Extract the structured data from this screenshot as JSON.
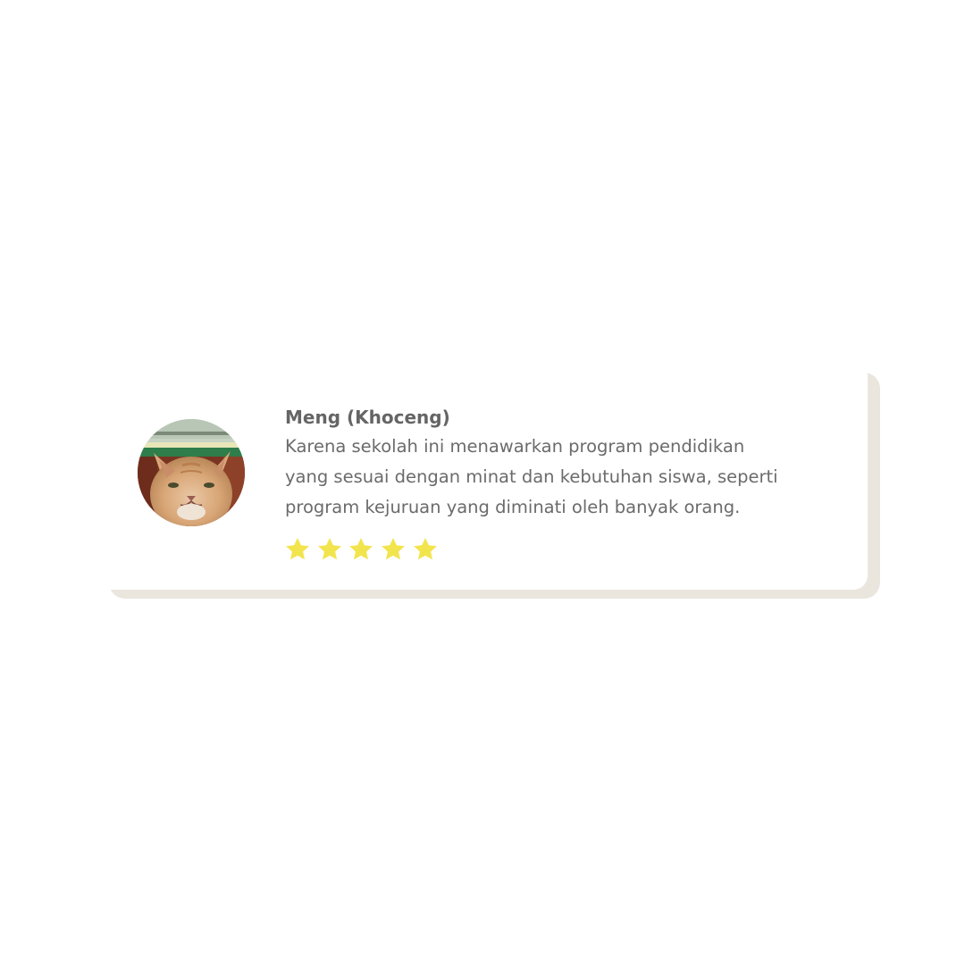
{
  "review": {
    "name": "Meng (Khoceng)",
    "lines": [
      "Karena sekolah ini menawarkan program pendidikan",
      "yang sesuai dengan minat dan kebutuhan siswa, seperti",
      "program kejuruan yang diminati oleh banyak orang."
    ],
    "rating": 5,
    "rating_max": 5,
    "avatar_icon": "cat-photo-avatar",
    "star_icon": "star-icon"
  },
  "colors": {
    "star": "#f2e44d",
    "card_shadow": "#eae6de",
    "name_text": "#656565",
    "body_text": "#6b6b6b"
  }
}
